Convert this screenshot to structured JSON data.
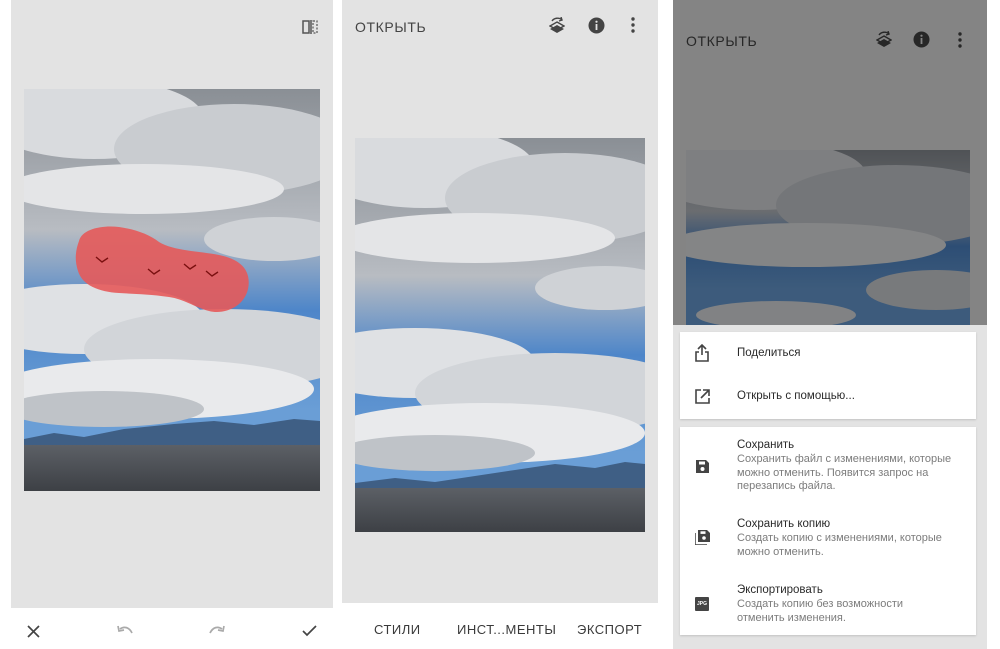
{
  "screen1": {
    "toolbar": {
      "compare_icon": "compare-icon"
    },
    "bottom_bar": {
      "cancel_icon": "close-icon",
      "undo_icon": "undo-icon",
      "redo_icon": "redo-icon",
      "apply_icon": "check-icon"
    }
  },
  "screen2": {
    "header": {
      "title": "ОТКРЫТЬ",
      "layers_icon": "layers-undo-icon",
      "info_icon": "info-icon",
      "more_icon": "more-vert-icon"
    },
    "tabs": [
      {
        "label": "СТИЛИ"
      },
      {
        "label": "ИНСТ...МЕНТЫ"
      },
      {
        "label": "ЭКСПОРТ"
      }
    ]
  },
  "screen3": {
    "header": {
      "title": "ОТКРЫТЬ",
      "layers_icon": "layers-undo-icon",
      "info_icon": "info-icon",
      "more_icon": "more-vert-icon"
    },
    "menu": {
      "share": {
        "title": "Поделиться",
        "icon": "share-icon"
      },
      "open_with": {
        "title": "Открыть с помощью...",
        "icon": "open-external-icon"
      },
      "save": {
        "title": "Сохранить",
        "desc_lines": [
          "Сохранить файл с изменениями, которые",
          "можно отменить. Появится запрос на",
          "перезапись файла."
        ],
        "icon": "save-icon"
      },
      "save_copy": {
        "title": "Сохранить копию",
        "desc_lines": [
          "Создать копию с изменениями, которые",
          "можно отменить."
        ],
        "icon": "save-copy-icon"
      },
      "export": {
        "title": "Экспортировать",
        "desc_lines": [
          "Создать копию без возможности",
          "отменить изменения."
        ],
        "icon": "jpg-icon",
        "icon_label": "JPG"
      }
    }
  }
}
